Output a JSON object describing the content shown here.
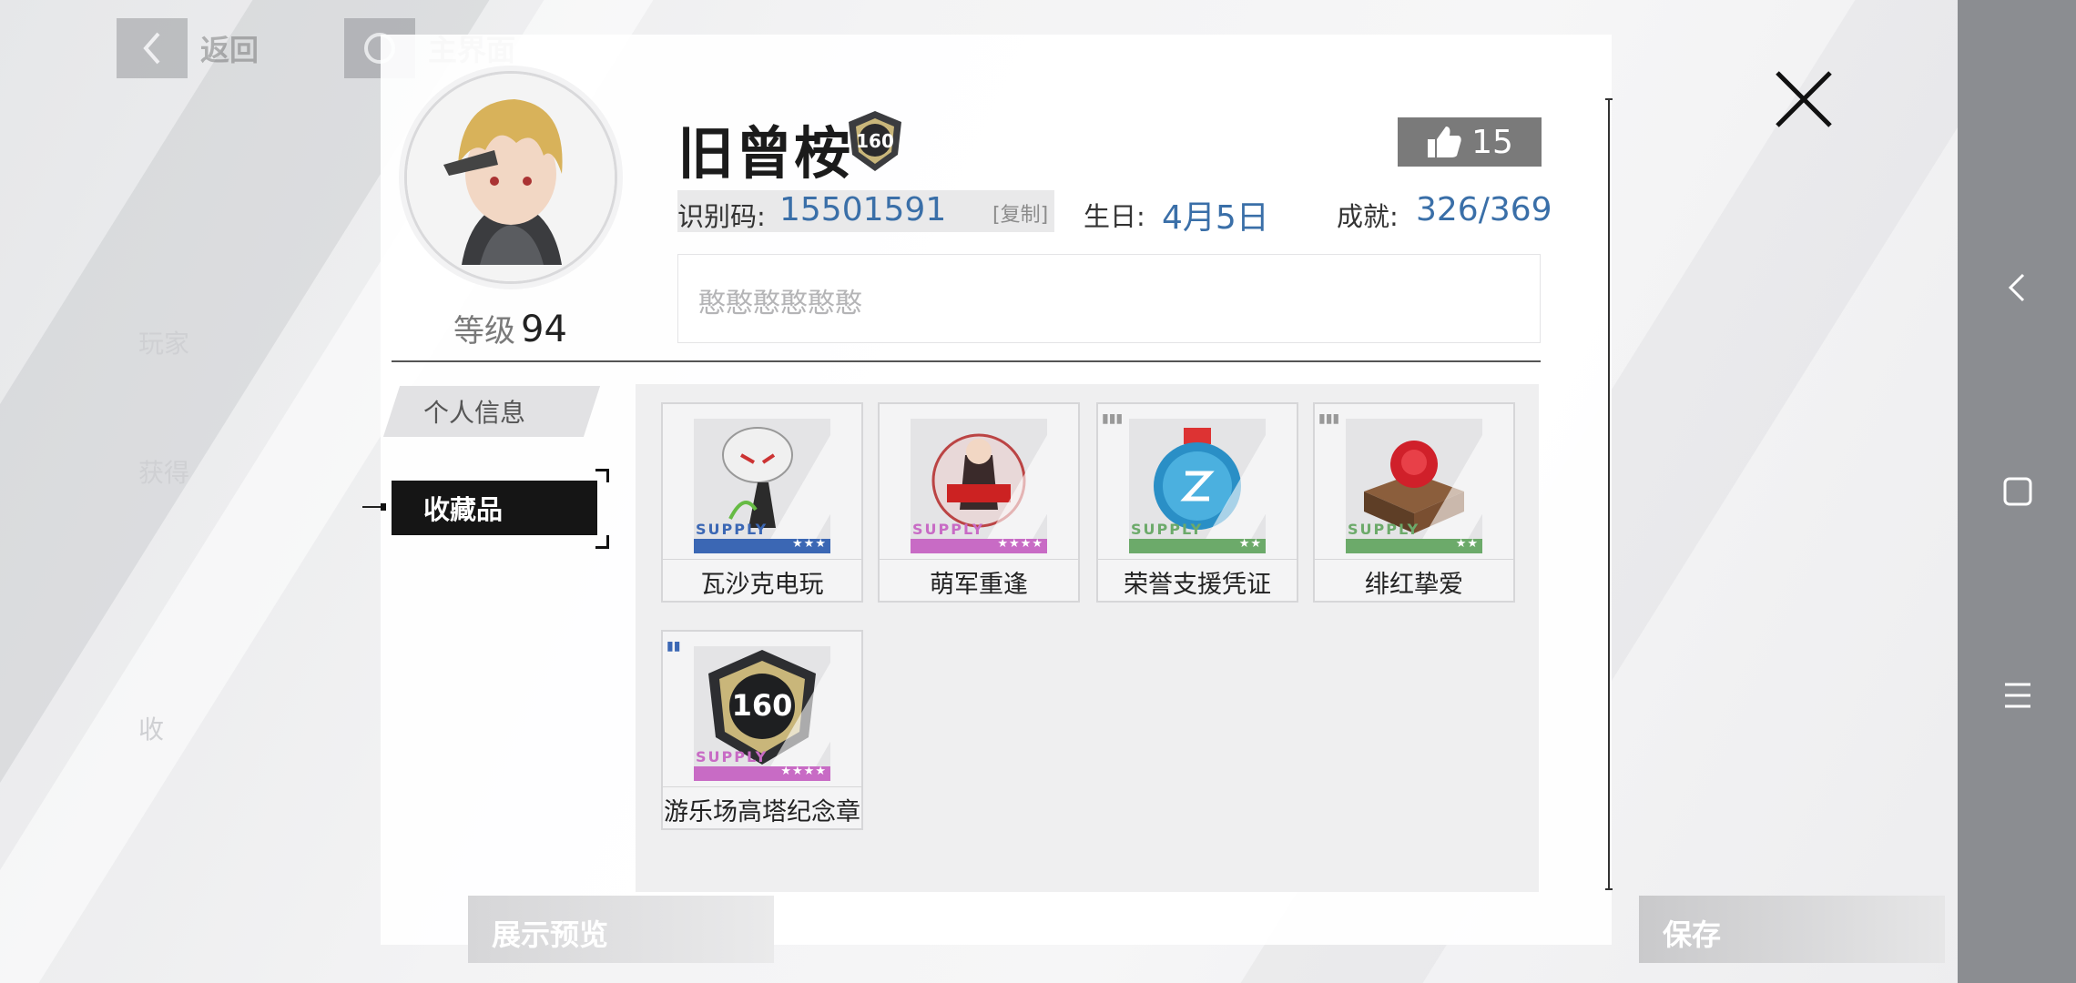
{
  "top_nav": {
    "back_label": "返回",
    "home_label": "主界面"
  },
  "ghost_menu": [
    "玩家",
    "获得",
    "收"
  ],
  "profile": {
    "level_label": "等级",
    "level_value": "94",
    "username": "旧曾桉",
    "badge_number": "160",
    "likes": "15",
    "id_label": "识别码:",
    "id_value": "15501591",
    "copy_label": "[复制]",
    "birthday_label": "生日:",
    "birthday_value": "4月5日",
    "achievement_label": "成就:",
    "achievement_value": "326/369",
    "signature": "憨憨憨憨憨憨"
  },
  "tabs": [
    {
      "label": "个人信息",
      "active": false
    },
    {
      "label": "收藏品",
      "active": true
    }
  ],
  "collection": [
    {
      "name": "瓦沙克电玩",
      "supply": "SUPPLY",
      "stars": "★★★",
      "rarity_color": "#3b67b4",
      "icon": "figurine-icon"
    },
    {
      "name": "萌军重逢",
      "supply": "SUPPLY",
      "stars": "★★★★",
      "rarity_color": "#c86bc5",
      "icon": "figure-display-icon"
    },
    {
      "name": "荣誉支援凭证",
      "supply": "SUPPLY",
      "stars": "★★",
      "rarity_color": "#6caa6a",
      "icon": "medal-globe-icon"
    },
    {
      "name": "绯红挚爱",
      "supply": "SUPPLY",
      "stars": "★★",
      "rarity_color": "#6caa6a",
      "icon": "rose-box-icon"
    },
    {
      "name": "游乐场高塔纪念章",
      "supply": "SUPPLY",
      "stars": "★★★★",
      "rarity_color": "#c86bc5",
      "icon": "badge-160-icon",
      "badge_text": "160"
    }
  ],
  "buttons": {
    "preview": "展示预览",
    "save": "保存"
  },
  "colors": {
    "link_blue": "#3a6fa8",
    "tab_active": "#151515",
    "likes_bg": "#7a7a7a"
  }
}
